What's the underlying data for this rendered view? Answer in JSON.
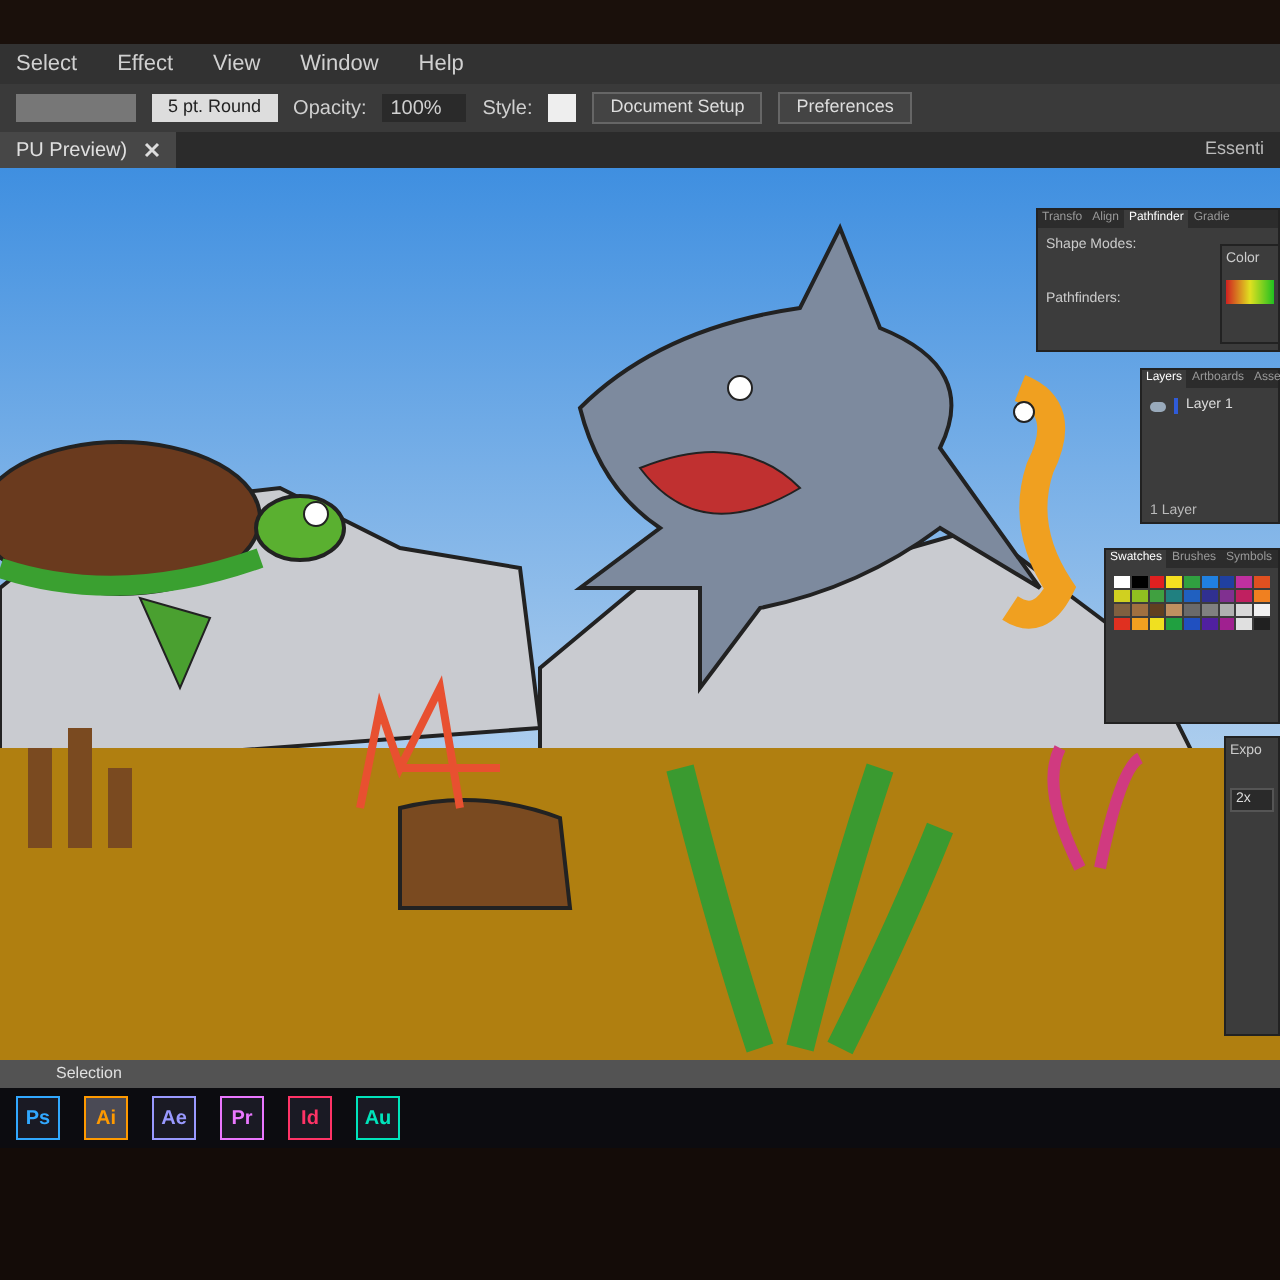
{
  "menu": [
    "Select",
    "Effect",
    "View",
    "Window",
    "Help"
  ],
  "control_bar": {
    "stroke": "5 pt. Round",
    "opacity_label": "Opacity:",
    "opacity": "100%",
    "style_label": "Style:",
    "buttons": [
      "Document Setup",
      "Preferences"
    ]
  },
  "document_tab": {
    "title": "PU Preview)"
  },
  "workspace": "Essenti",
  "pathfinder_panel": {
    "tabs": [
      {
        "label": "Transfo",
        "selected": false
      },
      {
        "label": "Align",
        "selected": false
      },
      {
        "label": "Pathfinder",
        "selected": true
      },
      {
        "label": "Gradie",
        "selected": false
      }
    ],
    "sections": [
      "Shape Modes:",
      "Pathfinders:"
    ]
  },
  "color_panel": {
    "title": "Color"
  },
  "layers_panel": {
    "tabs": [
      {
        "label": "Layers",
        "selected": true
      },
      {
        "label": "Artboards",
        "selected": false
      },
      {
        "label": "Asse",
        "selected": false
      }
    ],
    "layers": [
      {
        "name": "Layer 1",
        "visible": true,
        "color": "#2f5bd8"
      }
    ],
    "footer": "1 Layer"
  },
  "swatches_panel": {
    "tabs": [
      {
        "label": "Swatches",
        "selected": true
      },
      {
        "label": "Brushes",
        "selected": false
      },
      {
        "label": "Symbols",
        "selected": false
      }
    ],
    "swatches": [
      {
        "color": "#ffffff"
      },
      {
        "color": "#000000"
      },
      {
        "color": "#e02020"
      },
      {
        "color": "#f5e020"
      },
      {
        "color": "#30a040"
      },
      {
        "color": "#2080e0"
      },
      {
        "color": "#2040a0"
      },
      {
        "color": "#c030a0"
      },
      {
        "color": "#e05020"
      },
      {
        "color": "#d0d020"
      },
      {
        "color": "#90c020"
      },
      {
        "color": "#40a040"
      },
      {
        "color": "#208080"
      },
      {
        "color": "#2060c0"
      },
      {
        "color": "#303090"
      },
      {
        "color": "#803090"
      },
      {
        "color": "#c02060"
      },
      {
        "color": "#f08020"
      },
      {
        "color": "#806040"
      },
      {
        "color": "#a07040"
      },
      {
        "color": "#604020"
      },
      {
        "color": "#c09060"
      },
      {
        "color": "#6a6a6a"
      },
      {
        "color": "#808080"
      },
      {
        "color": "#b0b0b0"
      },
      {
        "color": "#d8d8d8"
      },
      {
        "color": "#f0f0f0"
      },
      {
        "color": "#e03020"
      },
      {
        "color": "#f0a020"
      },
      {
        "color": "#f0e020"
      },
      {
        "color": "#20a040"
      },
      {
        "color": "#2050c0"
      },
      {
        "color": "#5020a0"
      },
      {
        "color": "#a02090"
      },
      {
        "color": "#e0e0e0"
      },
      {
        "color": "#202020"
      }
    ]
  },
  "export_panel": {
    "title": "Expo",
    "scale": "2x"
  },
  "status_bar": {
    "tool": "Selection"
  },
  "taskbar": [
    {
      "label": "Ps",
      "color": "#31a8ff",
      "selected": false
    },
    {
      "label": "Ai",
      "color": "#ff9a00",
      "selected": true
    },
    {
      "label": "Ae",
      "color": "#9999ff",
      "selected": false
    },
    {
      "label": "Pr",
      "color": "#ea77ff",
      "selected": false
    },
    {
      "label": "Id",
      "color": "#ff3366",
      "selected": false
    },
    {
      "label": "Au",
      "color": "#00e4bb",
      "selected": false
    }
  ]
}
